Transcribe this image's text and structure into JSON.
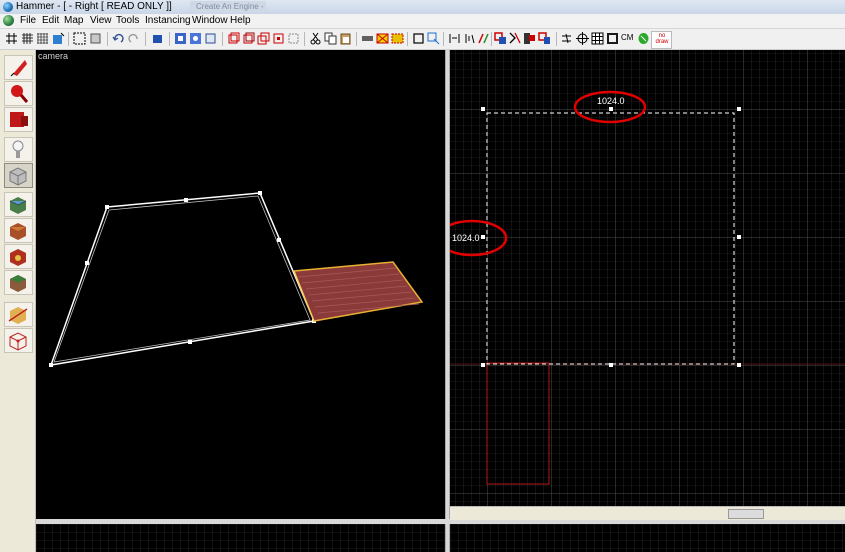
{
  "window": {
    "title": "Hammer - [ - Right [ READ ONLY ]]",
    "ghost_tab": "Create An Engine - Flamers"
  },
  "menubar": {
    "items": [
      "File",
      "Edit",
      "Map",
      "View",
      "Tools",
      "Instancing",
      "Window",
      "Help"
    ]
  },
  "toolbar": {
    "cm_label": "CM",
    "no_draw_label": "no draw"
  },
  "camera_view": {
    "label": "camera",
    "brush_color": "#8b3a3a",
    "brush_outline": "#e7b032"
  },
  "right_view": {
    "width_label": "1024.0",
    "height_label": "1024.0",
    "highlight_color": "#e00000",
    "selection_color": "#ffffff"
  }
}
